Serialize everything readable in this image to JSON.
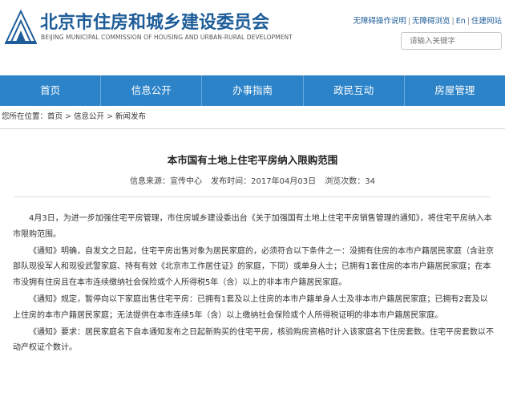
{
  "header": {
    "title_cn": "北京市住房和城乡建设委员会",
    "title_en": "BEIJING MUNICIPAL COMMISSION OF HOUSING AND URBAN-RURAL DEVELOPMENT",
    "links": [
      "无障碍操作说明",
      "无障碍浏览",
      "En",
      "住建网站"
    ],
    "search_placeholder": "请输入关键字",
    "brand_color": "#1f5d99"
  },
  "nav": {
    "color": "#2c83c8",
    "items": [
      "首页",
      "信息公开",
      "办事指南",
      "政民互动",
      "房屋管理"
    ]
  },
  "breadcrumb": {
    "prefix": "您所在位置：",
    "items": [
      "首页",
      "信息公开",
      "新闻发布"
    ],
    "separator": ">"
  },
  "article": {
    "title": "本市国有土地上住宅平房纳入限购范围",
    "source": "信息来源：宣传中心",
    "publish_time": "发布时间：2017年04月03日",
    "views": "浏览次数：34",
    "paragraphs": [
      "4月3日，为进一步加强住宅平房管理，市住房城乡建设委出台《关于加强国有土地上住宅平房销售管理的通知》，将住宅平房纳入本市限购范围。",
      "《通知》明确，自发文之日起，住宅平房出售对象为居民家庭的，必须符合以下条件之一：没拥有住房的本市户籍居民家庭（含驻京部队现役军人和现役武警家庭、持有有效《北京市工作居住证》的家庭，下同）或单身人士；已拥有1套住房的本市户籍居民家庭；在本市没拥有住房且在本市连续缴纳社会保险或个人所得税5年（含）以上的非本市户籍居民家庭。",
      "《通知》规定，暂停向以下家庭出售住宅平房：已拥有1套及以上住房的本市户籍单身人士及非本市户籍居民家庭；已拥有2套及以上住房的本市户籍居民家庭；无法提供在本市连续5年（含）以上缴纳社会保险或个人所得税证明的非本市户籍居民家庭。",
      "《通知》要求：居民家庭名下自本通知发布之日起新购买的住宅平房，核验购房资格时计入该家庭名下住房套数。住宅平房套数以不动产权证个数计。"
    ]
  }
}
